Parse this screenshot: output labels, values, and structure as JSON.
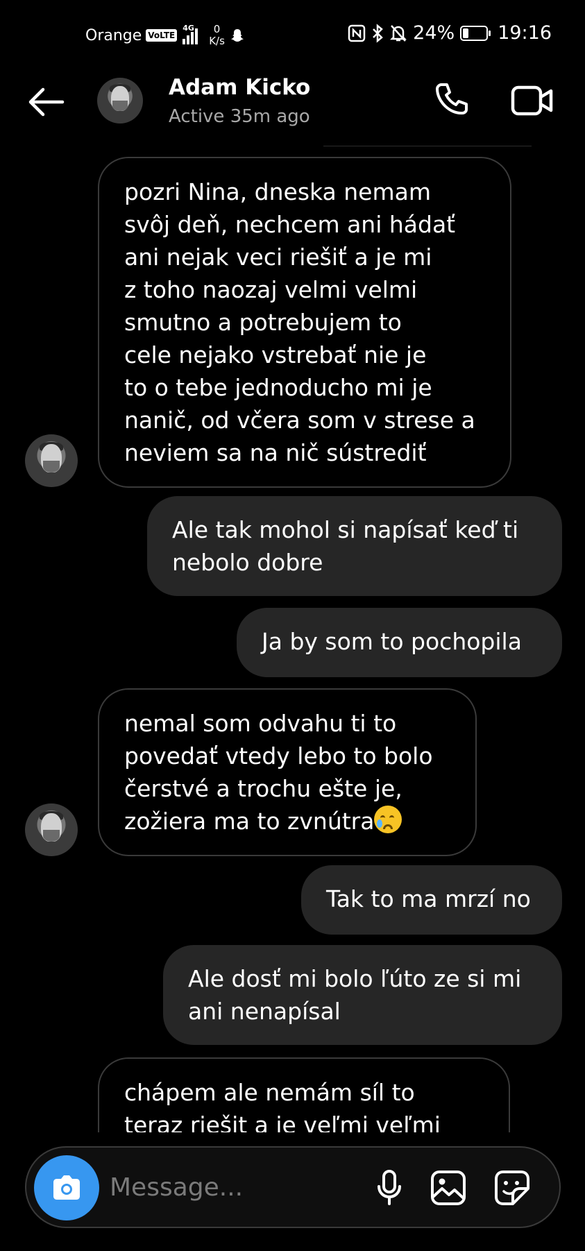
{
  "status_bar": {
    "carrier": "Orange",
    "volte": "VoLTE",
    "network_type": "4G",
    "speed_value": "0",
    "speed_unit": "K/s",
    "battery": "24%",
    "battery_level": 0.24,
    "time": "19:16"
  },
  "header": {
    "contact_name": "Adam Kicko",
    "activity": "Active 35m ago"
  },
  "messages": [
    {
      "from": "contact",
      "lines": [
        "pozri Nina, dneska nemam",
        "svôj deň, nechcem ani hádať",
        "ani nejak veci riešiť a je mi",
        "z toho naozaj velmi velmi",
        "smutno a potrebujem to",
        "cele nejako vstrebať nie je",
        "to o tebe jednoducho mi je",
        "nanič, od včera som v strese a",
        "neviem sa na nič sústrediť"
      ]
    },
    {
      "from": "me",
      "lines": [
        "Ale tak mohol si napísať keď ti",
        "nebolo dobre"
      ]
    },
    {
      "from": "me",
      "lines": [
        "Ja by som to pochopila"
      ]
    },
    {
      "from": "contact",
      "lines": [
        "nemal som odvahu ti to",
        "povedať vtedy lebo to bolo",
        "čerstvé a trochu ešte je,",
        "zožiera ma to zvnútra"
      ],
      "emoji": "crying-face"
    },
    {
      "from": "me",
      "lines": [
        "Tak to ma mrzí no"
      ]
    },
    {
      "from": "me",
      "lines": [
        "Ale dosť mi bolo ľúto ze si mi",
        "ani nenapísal"
      ]
    },
    {
      "from": "contact",
      "lines": [
        "chápem ale nemám síl to",
        "teraz riešit a je veľmi veľmi"
      ]
    }
  ],
  "composer": {
    "placeholder": "Message..."
  },
  "icons": {
    "back": "arrow-left-icon",
    "call": "phone-icon",
    "video": "video-camera-icon",
    "camera": "camera-icon",
    "mic": "microphone-icon",
    "gallery": "image-icon",
    "sticker": "sticker-icon"
  },
  "colors": {
    "background": "#000000",
    "outgoing_bubble": "#262626",
    "incoming_border": "#3a3a3a",
    "accent": "#3797f0",
    "secondary_text": "#a8a8a8"
  }
}
